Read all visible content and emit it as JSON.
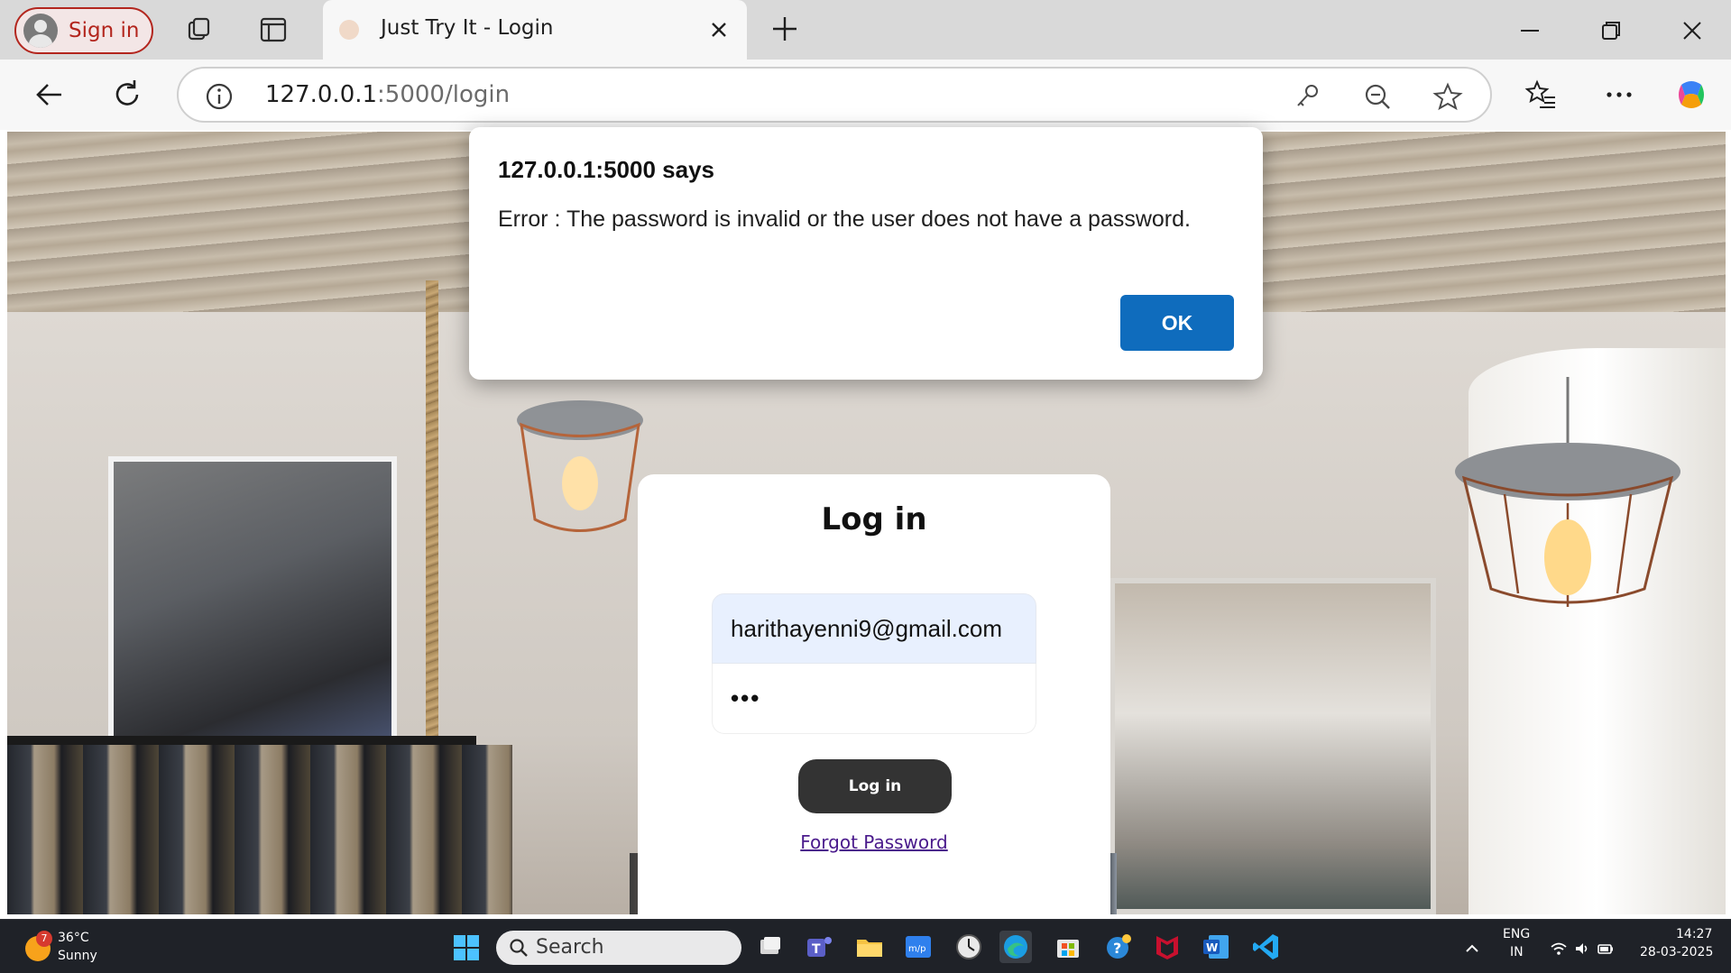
{
  "browser": {
    "signin_label": "Sign in",
    "tab_title": "Just Try It - Login",
    "url_host": "127.0.0.1",
    "url_path": ":5000/login"
  },
  "login": {
    "title": "Log in",
    "email_value": "harithayenni9@gmail.com",
    "password_mask": "•••",
    "button_label": "Log in",
    "forgot_label": "Forgot Password"
  },
  "alert": {
    "title": "127.0.0.1:5000 says",
    "message": "Error : The password is invalid or the user does not have a password.",
    "ok_label": "OK"
  },
  "taskbar": {
    "weather_badge": "7",
    "temperature": "36°C",
    "condition": "Sunny",
    "search_label": "Search",
    "lang_top": "ENG",
    "lang_bottom": "IN",
    "time": "14:27",
    "date": "28-03-2025"
  },
  "colors": {
    "accent_blue": "#0f6cbd",
    "signin_red": "#b3261e",
    "autofill_blue": "#e8f0fe",
    "dark_button": "#333333"
  },
  "icons": {
    "tab_strip": [
      "workspaces-icon",
      "vertical-tabs-icon"
    ],
    "toolbar": [
      "back-icon",
      "refresh-icon",
      "info-icon",
      "key-icon",
      "zoom-out-icon",
      "favorite-star-icon",
      "favorites-list-icon",
      "more-icon",
      "copilot-icon"
    ],
    "taskbar_apps": [
      "task-view-icon",
      "teams-icon",
      "file-explorer-icon",
      "mcafee-vpn-icon",
      "clock-icon",
      "edge-icon",
      "store-icon",
      "help-icon",
      "mcafee-icon",
      "word-icon",
      "vscode-icon"
    ]
  }
}
